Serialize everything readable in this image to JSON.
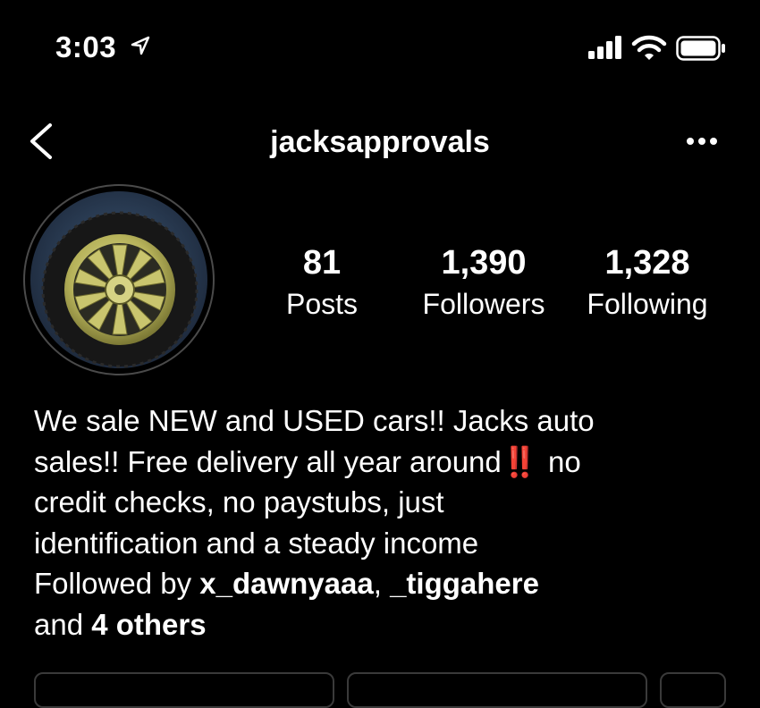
{
  "status_bar": {
    "time": "3:03",
    "icons": [
      "location-arrow-icon",
      "cellular-signal-icon",
      "wifi-icon",
      "battery-icon"
    ]
  },
  "nav": {
    "username": "jacksapprovals",
    "back_icon": "chevron-left-icon",
    "more_icon": "more-horizontal-icon"
  },
  "profile": {
    "avatar": "car-wheel-photo",
    "stats": [
      {
        "count": "81",
        "label": "Posts"
      },
      {
        "count": "1,390",
        "label": "Followers"
      },
      {
        "count": "1,328",
        "label": "Following"
      }
    ]
  },
  "bio": {
    "line1": "We sale NEW and USED cars!! Jacks auto",
    "line2a": "sales!! Free delivery all year around",
    "emoji": "‼️",
    "line2b": " no",
    "line3": "credit checks, no paystubs, just",
    "line4": "identification and a steady income"
  },
  "followed_by": {
    "prefix": "Followed by ",
    "user1": "x_dawnyaaa",
    "sep": ", ",
    "user2": "_tiggahere",
    "and": "and ",
    "others": "4 others"
  },
  "colors": {
    "background": "#000000",
    "text": "#ffffff",
    "emoji_red": "#d8322b",
    "button_border": "#3a3a3a"
  }
}
